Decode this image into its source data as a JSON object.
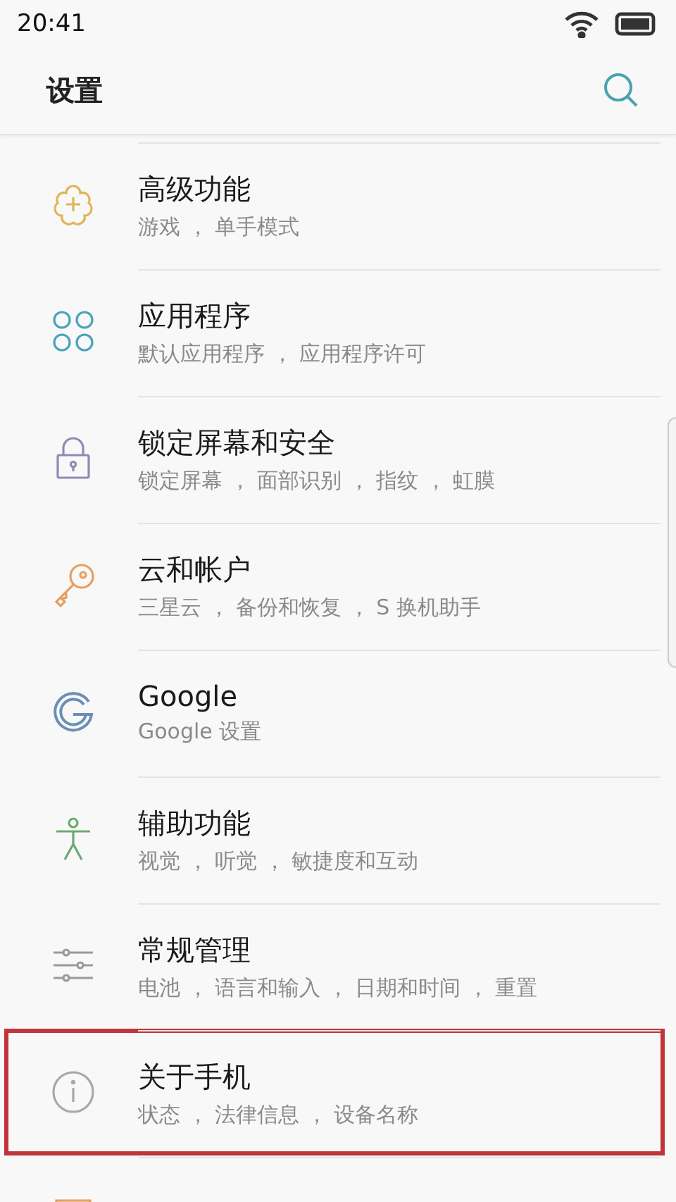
{
  "status_bar": {
    "time": "20:41"
  },
  "header": {
    "title": "设置"
  },
  "items": [
    {
      "kind": "advanced",
      "title": "高级功能",
      "subtitle": "游戏 ， 单手模式",
      "highlighted": false
    },
    {
      "kind": "apps",
      "title": "应用程序",
      "subtitle": "默认应用程序 ， 应用程序许可",
      "highlighted": false
    },
    {
      "kind": "lock",
      "title": "锁定屏幕和安全",
      "subtitle": "锁定屏幕 ， 面部识别 ， 指纹 ， 虹膜",
      "highlighted": false
    },
    {
      "kind": "key",
      "title": "云和帐户",
      "subtitle": "三星云 ， 备份和恢复 ， S 换机助手",
      "highlighted": false
    },
    {
      "kind": "google",
      "title": "Google",
      "subtitle": "Google 设置",
      "highlighted": false
    },
    {
      "kind": "accessibility",
      "title": "辅助功能",
      "subtitle": "视觉 ， 听觉 ， 敏捷度和互动",
      "highlighted": false
    },
    {
      "kind": "sliders",
      "title": "常规管理",
      "subtitle": "电池 ， 语言和输入 ， 日期和时间 ， 重置",
      "highlighted": false
    },
    {
      "kind": "info",
      "title": "关于手机",
      "subtitle": "状态 ， 法律信息 ， 设备名称",
      "highlighted": true
    },
    {
      "kind": "manual",
      "highlighted": false
    }
  ]
}
